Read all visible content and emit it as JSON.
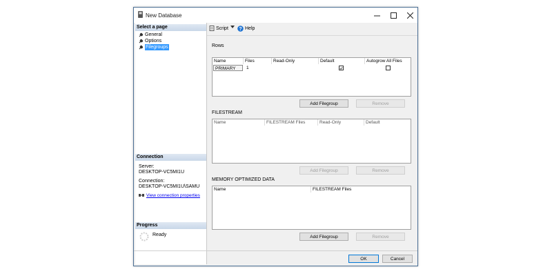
{
  "window": {
    "title": "New Database"
  },
  "left_pane": {
    "select_page_header": "Select a page",
    "pages": [
      {
        "label": "General",
        "selected": false
      },
      {
        "label": "Options",
        "selected": false
      },
      {
        "label": "Filegroups",
        "selected": true
      }
    ],
    "connection_header": "Connection",
    "server_label": "Server:",
    "server_value": "DESKTOP-VC5MI1U",
    "connection_label": "Connection:",
    "connection_value": "DESKTOP-VC5MI1U\\SAMU",
    "view_connection_link": "View connection properties",
    "progress_header": "Progress",
    "progress_status": "Ready"
  },
  "toolbar": {
    "script_label": "Script",
    "help_label": "Help"
  },
  "rows": {
    "title": "Rows",
    "columns": [
      "Name",
      "Files",
      "Read-Only",
      "Default",
      "Autogrow All Files"
    ],
    "items": [
      {
        "name": "PRIMARY",
        "files": "1",
        "read_only": false,
        "default": true,
        "autogrow": false
      }
    ],
    "add_button": "Add Filegroup",
    "remove_button": "Remove"
  },
  "filestream": {
    "title": "FILESTREAM",
    "columns": [
      "Name",
      "FILESTREAM Files",
      "Read-Only",
      "Default"
    ],
    "add_button": "Add Filegroup",
    "remove_button": "Remove"
  },
  "memory_optimized": {
    "title": "MEMORY OPTIMIZED DATA",
    "columns": [
      "Name",
      "FILESTREAM Files"
    ],
    "add_button": "Add Filegroup",
    "remove_button": "Remove"
  },
  "footer": {
    "ok_label": "OK",
    "cancel_label": "Cancel"
  },
  "colors": {
    "accent": "#0078d7",
    "selection": "#3399ff",
    "link": "#0000ee",
    "section_header": "#c9d7e8"
  }
}
